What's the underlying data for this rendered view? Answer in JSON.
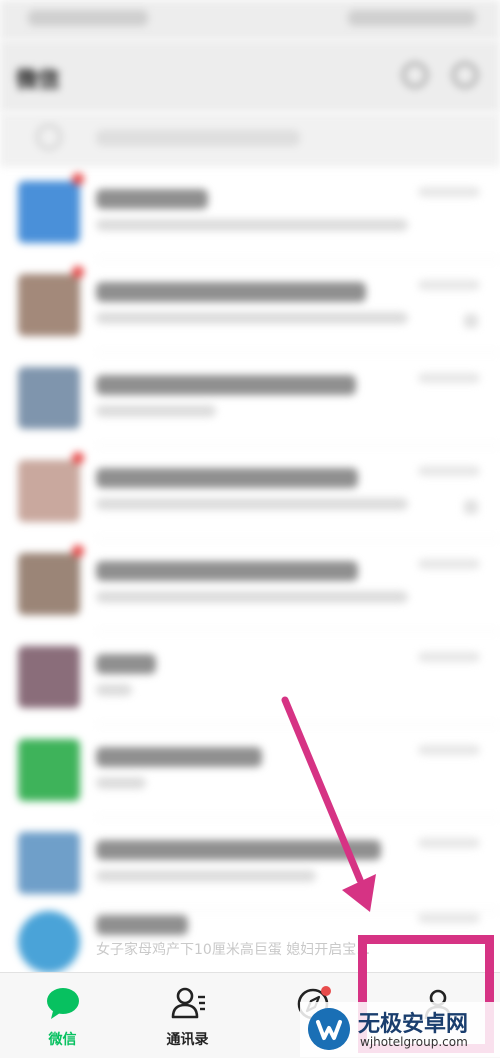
{
  "colors": {
    "accent": "#07c160",
    "badge": "#e84c4c",
    "highlight": "#d63384",
    "watermark_blue": "#1a6fb5"
  },
  "chat_list": {
    "last_item_preview": "女子家母鸡产下10厘米高巨蛋 媳妇开启宝…"
  },
  "tab_bar": {
    "tabs": [
      {
        "label": "微信",
        "icon": "chat-bubble-icon",
        "active": true
      },
      {
        "label": "通讯录",
        "icon": "contacts-icon",
        "active": false
      },
      {
        "label": "",
        "icon": "compass-icon",
        "active": false
      },
      {
        "label": "",
        "icon": "person-icon",
        "active": false
      }
    ]
  },
  "watermark": {
    "title": "无极安卓网",
    "url": "wjhotelgroup.com"
  }
}
